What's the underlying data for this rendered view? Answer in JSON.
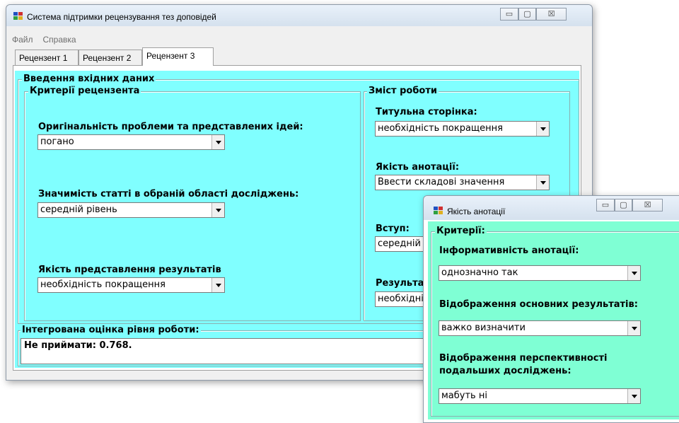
{
  "main_window": {
    "title": "Система підтримки рецензування тез доповідей",
    "menu": [
      "Файл",
      "Справка"
    ],
    "tabs": [
      "Рецензент 1",
      "Рецензент 2",
      "Рецензент 3"
    ],
    "active_tab": "Рецензент 3",
    "input_group_label": "Введення вхідних даних",
    "criteria_group": {
      "label": "Критерії рецензента",
      "fields": [
        {
          "label": "Оригінальність проблеми та представлених ідей:",
          "value": "погано"
        },
        {
          "label": "Значимість статті в обраній області досліджень:",
          "value": "середній рівень"
        },
        {
          "label": "Якість представлення результатів",
          "value": "необхідність покращення"
        }
      ]
    },
    "content_group": {
      "label": "Зміст роботи",
      "fields": [
        {
          "label": "Титульна сторінка:",
          "value": "необхідність покращення"
        },
        {
          "label": "Якість анотації:",
          "value": "Ввести складові значення"
        },
        {
          "label": "Вступ:",
          "value": "середній рівень"
        },
        {
          "label": "Результати",
          "value": "необхідність покращення"
        }
      ]
    },
    "integrated": {
      "label": "Інтегрована оцінка рівня роботи:",
      "value": "Не приймати: 0.768."
    },
    "panel_color": "#80ffff"
  },
  "dialog": {
    "title": "Якість анотації",
    "group_label": "Критерії:",
    "fields": [
      {
        "label": "Інформативність анотації:",
        "value": "однозначно так"
      },
      {
        "label": "Відображення основних результатів:",
        "value": "важко визначити"
      },
      {
        "label_line1": "Відображення перспективності",
        "label_line2": "подальших досліджень:",
        "value": "мабуть ні"
      }
    ],
    "panel_color": "#7fffd4"
  },
  "caption_buttons": {
    "minimize": "▭",
    "maximize": "▢",
    "close": "☒"
  }
}
